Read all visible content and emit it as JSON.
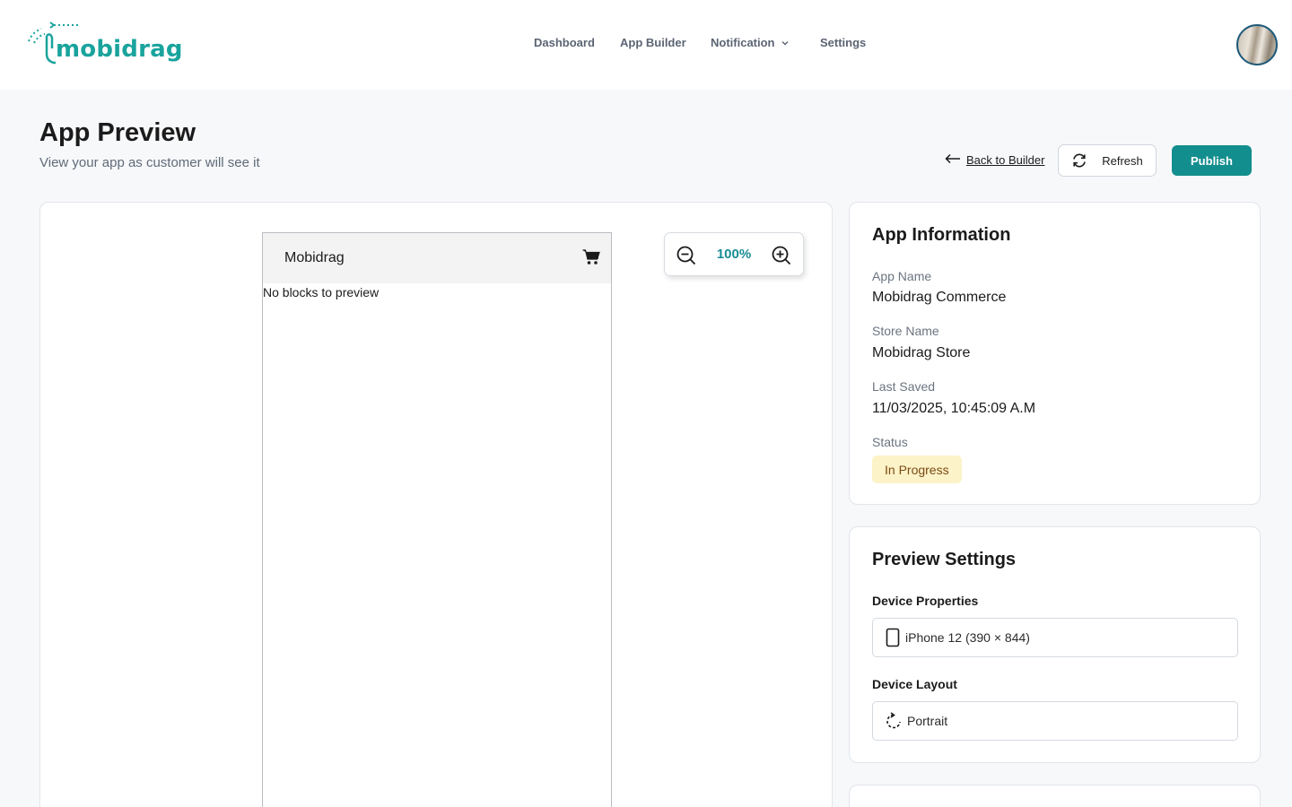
{
  "brand": {
    "logo_text": "mobidrag",
    "accent_color": "#138e8e"
  },
  "nav": {
    "items": [
      {
        "label": "Dashboard"
      },
      {
        "label": "App Builder"
      },
      {
        "label": "Notification",
        "has_dropdown": true
      },
      {
        "label": "Settings"
      }
    ]
  },
  "user": {
    "avatar_icon": "avatar"
  },
  "page": {
    "title": "App Preview",
    "subtitle": "View your app as customer will see it",
    "back_label": "Back to Builder",
    "refresh_label": "Refresh",
    "publish_label": "Publish"
  },
  "preview": {
    "app_title": "Mobidrag",
    "cart_icon": "cart-icon",
    "empty_text": "No blocks to preview",
    "zoom": "100%"
  },
  "app_info": {
    "title": "App Information",
    "fields": [
      {
        "label": "App Name",
        "value": "Mobidrag Commerce"
      },
      {
        "label": "Store Name",
        "value": "Mobidrag Store"
      },
      {
        "label": "Last Saved",
        "value": "11/03/2025, 10:45:09 A.M"
      }
    ],
    "status_label": "Status",
    "status_value": "In Progress",
    "status_color": "#fdf3c9"
  },
  "preview_settings": {
    "title": "Preview Settings",
    "device_label": "Device Properties",
    "device_value": "iPhone 12 (390 × 844)",
    "layout_label": "Device Layout",
    "layout_value": "Portrait"
  }
}
